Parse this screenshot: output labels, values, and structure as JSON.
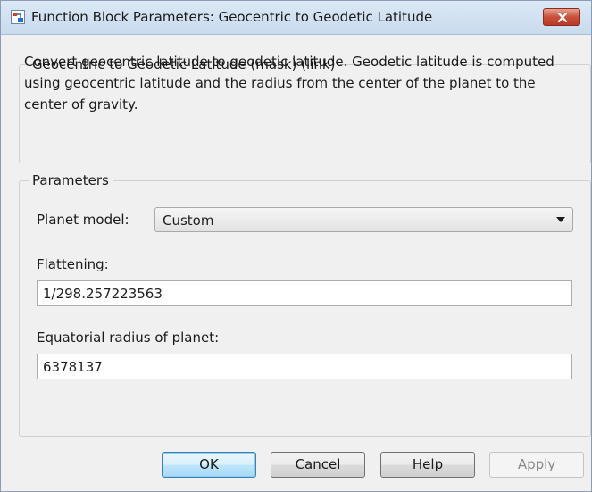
{
  "window": {
    "title": "Function Block Parameters: Geocentric to Geodetic Latitude"
  },
  "header_group": {
    "legend": "Geocentric to Geodetic Latitude (mask) (link)",
    "description": "Convert geocentric latitude to geodetic latitude.  Geodetic latitude is computed using geocentric latitude and the radius from the center of the planet to the center of gravity."
  },
  "parameters": {
    "legend": "Parameters",
    "planet_model_label": "Planet model:",
    "planet_model_value": "Custom",
    "flattening_label": "Flattening:",
    "flattening_value": "1/298.257223563",
    "radius_label": "Equatorial radius of planet:",
    "radius_value": "6378137"
  },
  "buttons": {
    "ok": "OK",
    "cancel": "Cancel",
    "help": "Help",
    "apply": "Apply"
  },
  "colors": {
    "accent": "#3c7fb1",
    "close": "#c9503a"
  },
  "icons": {
    "app": "simulink-block-icon",
    "close": "close-icon",
    "dropdown": "chevron-down-icon"
  }
}
